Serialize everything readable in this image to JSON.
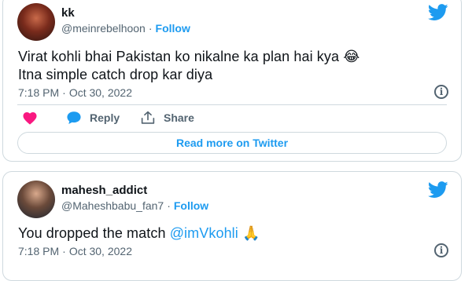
{
  "tweets": [
    {
      "display_name": "kk",
      "handle": "@meinrebelhoon",
      "follow_label": "Follow",
      "text_line1": "Virat kohli bhai Pakistan ko nikalne ka plan hai kya",
      "emoji": "😂",
      "text_line2": "Itna simple catch drop kar diya",
      "time": "7:18 PM",
      "date": "Oct 30, 2022",
      "reply_label": "Reply",
      "share_label": "Share",
      "read_more_label": "Read more on Twitter",
      "icons": [
        "avatar",
        "twitter-bird-icon",
        "info-icon",
        "heart-icon",
        "reply-bubble-icon",
        "share-icon"
      ]
    },
    {
      "display_name": "mahesh_addict",
      "handle": "@Maheshbabu_fan7",
      "follow_label": "Follow",
      "text_prefix": "You dropped the match",
      "mention": "@imVkohli",
      "emoji": "🙏",
      "time": "7:18 PM",
      "date": "Oct 30, 2022",
      "icons": [
        "avatar",
        "twitter-bird-icon",
        "info-icon"
      ]
    }
  ],
  "colors": {
    "accent": "#1d9bf0",
    "like": "#f91880",
    "muted": "#536471",
    "border": "#cfd9de"
  }
}
